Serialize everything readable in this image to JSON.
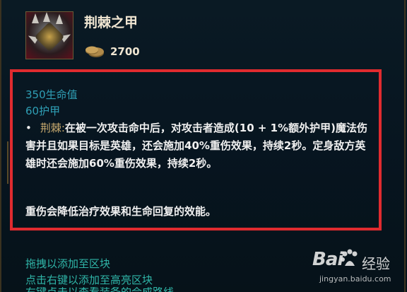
{
  "item": {
    "name": "荆棘之甲",
    "gold": "2700",
    "icon": "thornmail-item-icon"
  },
  "stats": [
    {
      "text": "350生命值"
    },
    {
      "text": "60护甲"
    }
  ],
  "passive": {
    "bullet": "•",
    "name": "荆棘:",
    "description": "在被一次攻击命中后，对攻击者造成(10 + 1%额外护甲)魔法伤害并且如果目标是英雄，还会施加40%重伤效果，持续2秒。定身敌方英雄时还会施加60%重伤效果，持续2秒。"
  },
  "note": "重伤会降低治疗效果和生命回复的效能。",
  "hints": [
    "拖拽以添加至区块",
    "点击右键以添加至高亮区块",
    "右键点击以查看装备的合成路线"
  ],
  "watermark": {
    "brand": "Bai",
    "brand_suffix": "经验",
    "url": "jingyan.baidu.com"
  },
  "colors": {
    "background": "#061219",
    "stat_text": "#2f9fb5",
    "hint_text": "#2fb5a8",
    "passive_name": "#c8aa6e",
    "highlight_border": "#e02b2f",
    "frame_gold": "#6b5a35"
  }
}
